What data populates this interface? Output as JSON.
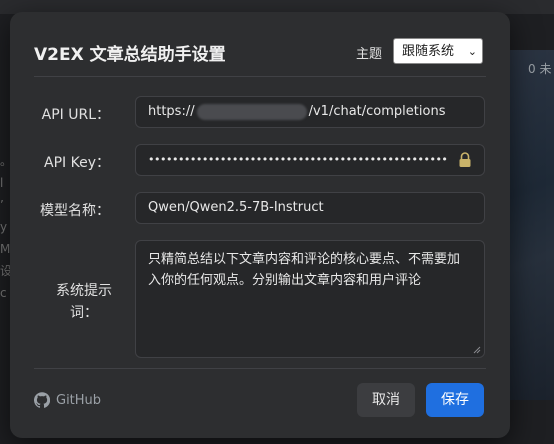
{
  "background": {
    "right_text": "0 未",
    "left_text": [
      "。",
      "l",
      "’",
      "y",
      "M",
      "设",
      "c"
    ]
  },
  "modal": {
    "title": "V2EX 文章总结助手设置",
    "theme": {
      "label": "主题",
      "selected": "跟随系统"
    },
    "api_url": {
      "label": "API URL：",
      "value_prefix": "https://",
      "value_suffix": "/v1/chat/completions"
    },
    "api_key": {
      "label": "API Key：",
      "value": "••••••••••••••••••••••••••••••••••••••••••••••••••"
    },
    "model": {
      "label": "模型名称：",
      "value": "Qwen/Qwen2.5-7B-Instruct"
    },
    "system_prompt": {
      "label": "系统提示词：",
      "value": "只精简总结以下文章内容和评论的核心要点、不需要加入你的任何观点。分别输出文章内容和用户评论"
    },
    "github_label": "GitHub",
    "buttons": {
      "cancel": "取消",
      "save": "保存"
    }
  },
  "colors": {
    "accent": "#1f6fe0",
    "modal_bg": "#2d2e30",
    "field_bg": "#262729"
  }
}
